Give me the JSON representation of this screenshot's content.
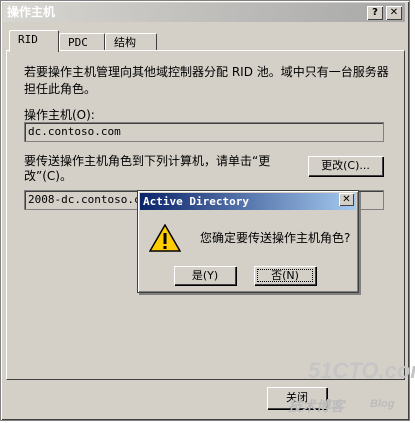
{
  "window": {
    "title": "操作主机",
    "help_btn": "?",
    "close_btn": "✕"
  },
  "tabs": [
    {
      "label": "RID",
      "active": true
    },
    {
      "label": "PDC",
      "active": false
    },
    {
      "label": "结构",
      "active": false
    }
  ],
  "panel": {
    "description": "若要操作主机管理向其他域控制器分配 RID 池。域中只有一台服务器担任此角色。",
    "host_label": "操作主机(O):",
    "host_value": "dc.contoso.com",
    "transfer_label": "要传送操作主机角色到下列计算机，请单击“更改”(C)。",
    "target_value": "2008-dc.contoso.com",
    "change_button": "更改(C)..."
  },
  "dialog": {
    "title": "Active Directory",
    "message": "您确定要传送操作主机角色?",
    "yes_button": "是(Y)",
    "no_button": "否(N)",
    "icon": "warning-icon"
  },
  "footer": {
    "close_button": "关闭"
  },
  "watermark": {
    "site": "51CTO.com",
    "sub": "技术博客",
    "blog": "Blog"
  },
  "colors": {
    "window_bg": "#d4d0c8",
    "dialog_title": "#0a246a",
    "warning": "#ffcc00"
  }
}
